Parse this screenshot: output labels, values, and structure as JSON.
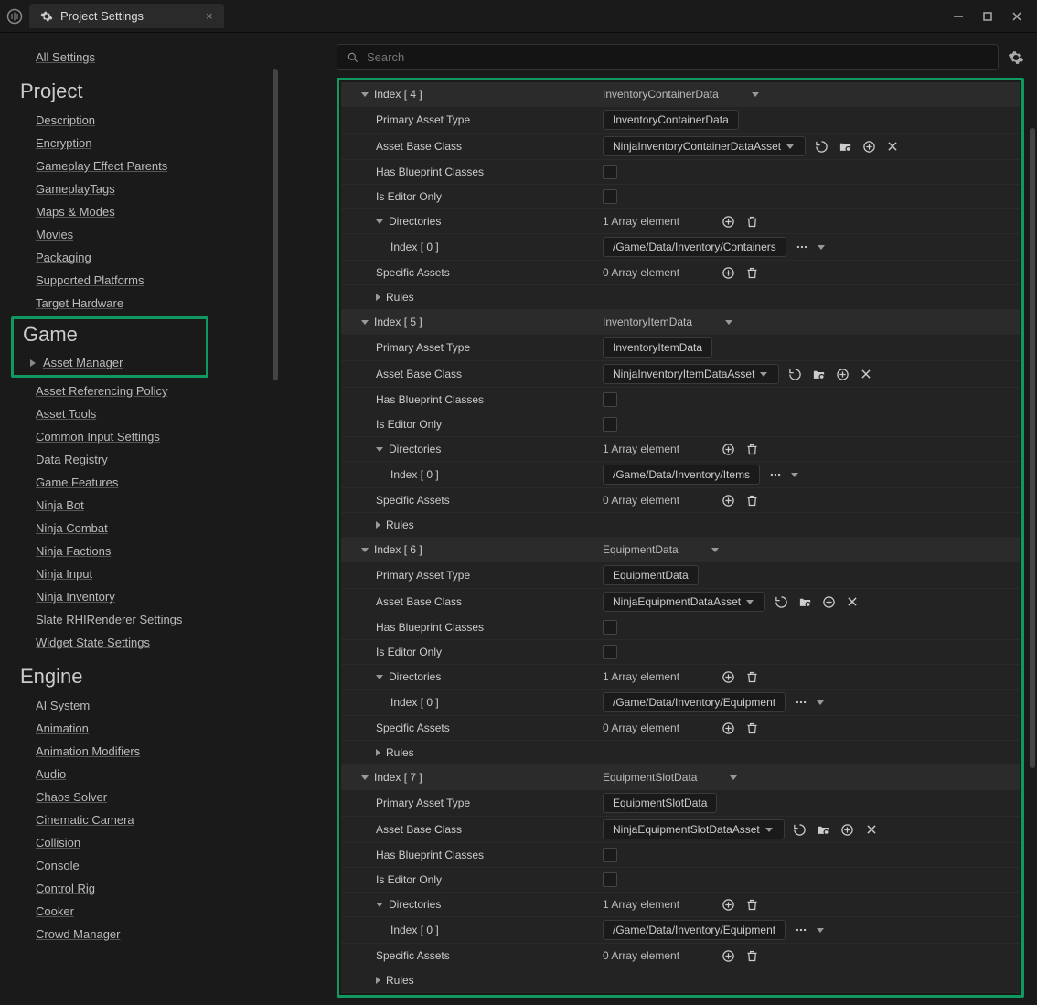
{
  "window": {
    "title": "Project Settings"
  },
  "search": {
    "placeholder": "Search"
  },
  "sidebar": {
    "all_settings": "All Settings",
    "sections": [
      {
        "title": "Project",
        "items": [
          "Description",
          "Encryption",
          "Gameplay Effect Parents",
          "GameplayTags",
          "Maps & Modes",
          "Movies",
          "Packaging",
          "Supported Platforms",
          "Target Hardware"
        ]
      },
      {
        "title": "Game",
        "highlight": true,
        "items": [
          "Asset Manager",
          "Asset Referencing Policy",
          "Asset Tools",
          "Common Input Settings",
          "Data Registry",
          "Game Features",
          "Ninja Bot",
          "Ninja Combat",
          "Ninja Factions",
          "Ninja Input",
          "Ninja Inventory",
          "Slate RHIRenderer Settings",
          "Widget State Settings"
        ]
      },
      {
        "title": "Engine",
        "items": [
          "AI System",
          "Animation",
          "Animation Modifiers",
          "Audio",
          "Chaos Solver",
          "Cinematic Camera",
          "Collision",
          "Console",
          "Control Rig",
          "Cooker",
          "Crowd Manager"
        ]
      }
    ]
  },
  "labels": {
    "index": "Index",
    "primary_asset_type": "Primary Asset Type",
    "asset_base_class": "Asset Base Class",
    "has_blueprint_classes": "Has Blueprint Classes",
    "is_editor_only": "Is Editor Only",
    "directories": "Directories",
    "specific_assets": "Specific Assets",
    "rules": "Rules",
    "array_1": "1 Array element",
    "array_0": "0 Array element"
  },
  "entries": [
    {
      "index": 4,
      "name": "InventoryContainerData",
      "base_class": "NinjaInventoryContainerDataAsset",
      "dir_path": "/Game/Data/Inventory/Containers"
    },
    {
      "index": 5,
      "name": "InventoryItemData",
      "base_class": "NinjaInventoryItemDataAsset",
      "dir_path": "/Game/Data/Inventory/Items"
    },
    {
      "index": 6,
      "name": "EquipmentData",
      "base_class": "NinjaEquipmentDataAsset",
      "dir_path": "/Game/Data/Inventory/Equipment"
    },
    {
      "index": 7,
      "name": "EquipmentSlotData",
      "base_class": "NinjaEquipmentSlotDataAsset",
      "dir_path": "/Game/Data/Inventory/Equipment"
    }
  ]
}
